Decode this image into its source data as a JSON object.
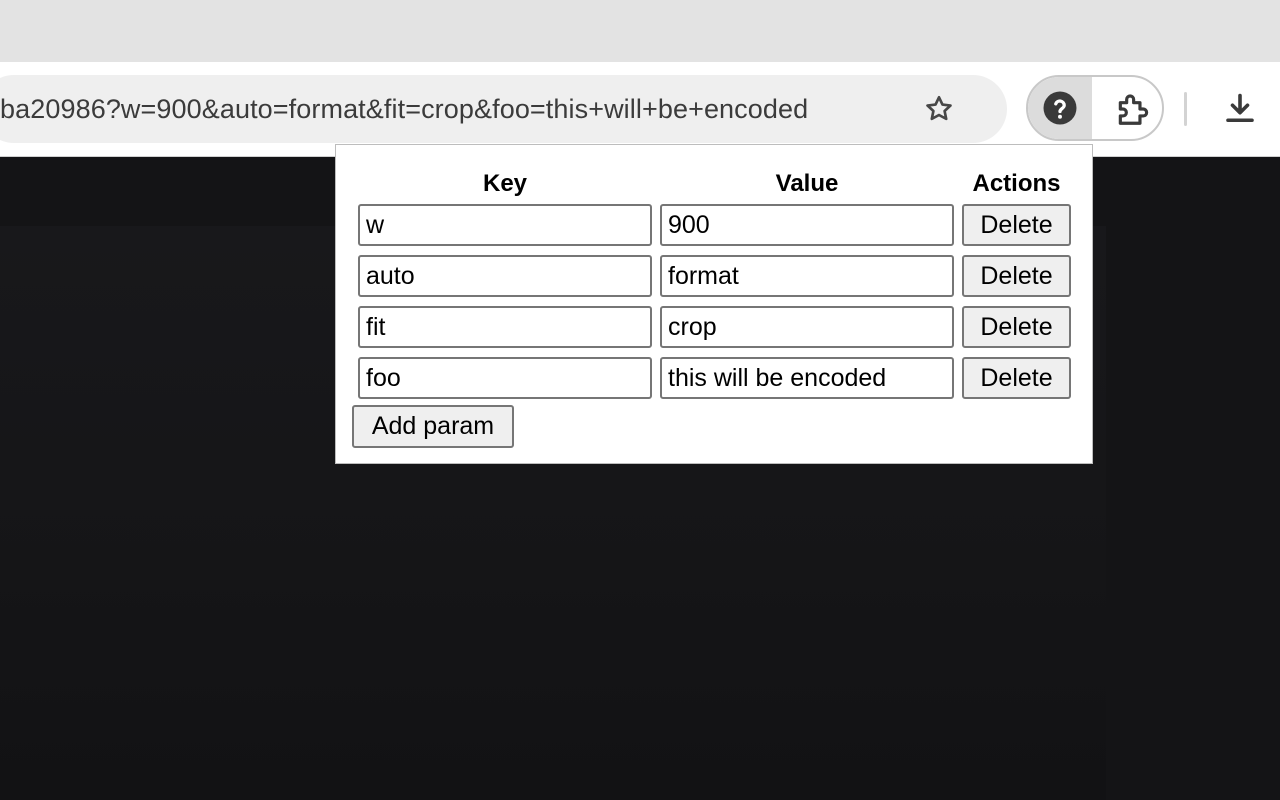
{
  "browser": {
    "url": "ba20986?w=900&auto=format&fit=crop&foo=this+will+be+encoded",
    "icons": {
      "bookmark": "star-icon",
      "active_extension": "help-circle-icon",
      "extensions_menu": "puzzle-piece-icon",
      "downloads": "download-icon"
    }
  },
  "popup": {
    "headers": {
      "key": "Key",
      "value": "Value",
      "actions": "Actions"
    },
    "rows": [
      {
        "key": "w",
        "value": "900",
        "delete_label": "Delete"
      },
      {
        "key": "auto",
        "value": "format",
        "delete_label": "Delete"
      },
      {
        "key": "fit",
        "value": "crop",
        "delete_label": "Delete"
      },
      {
        "key": "foo",
        "value": "this will be encoded",
        "delete_label": "Delete"
      }
    ],
    "add_label": "Add param"
  },
  "colors": {
    "toolbar": "#ffffff",
    "tabstrip": "#e3e3e3",
    "omnibox": "#efefef",
    "page_background": "#141416"
  }
}
